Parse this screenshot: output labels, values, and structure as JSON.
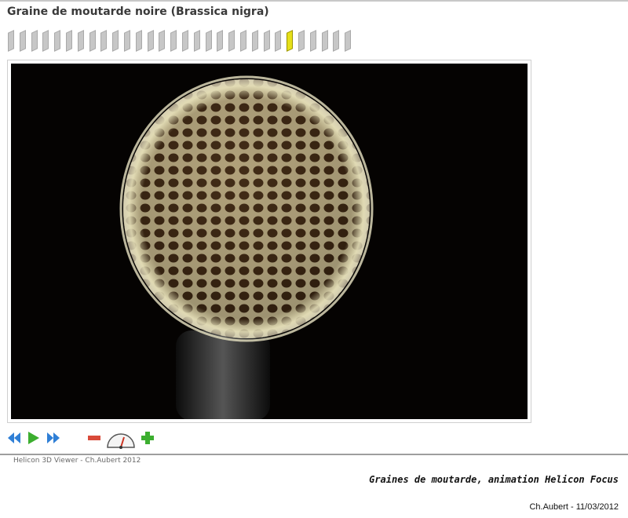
{
  "page": {
    "title": "Graine de moutarde noire (Brassica nigra)",
    "credit": "Helicon 3D Viewer - Ch.Aubert 2012",
    "caption": "Graines de moutarde, animation Helicon Focus",
    "date": "Ch.Aubert - 11/03/2012"
  },
  "frames": {
    "count": 30,
    "active_index": 24,
    "active_color": "#e6e01a",
    "inactive_color": "#c7c7c7"
  },
  "controls": {
    "prev": "double-left-arrow-icon",
    "play": "play-triangle-icon",
    "next": "double-right-arrow-icon",
    "zoom_out": "minus-icon",
    "speed": "speedometer-icon",
    "zoom_in": "plus-icon"
  },
  "colors": {
    "accent_blue": "#2f7fd6",
    "accent_green": "#3cae2f",
    "accent_red": "#d94a3a"
  }
}
